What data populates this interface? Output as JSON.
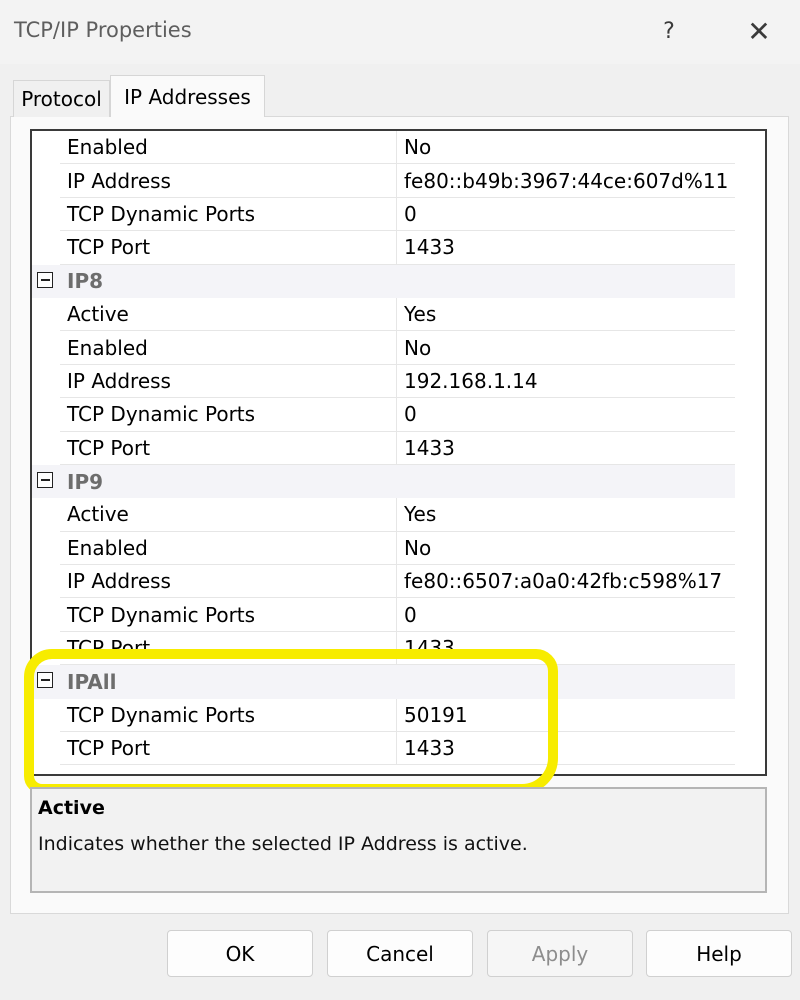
{
  "window": {
    "title": "TCP/IP Properties",
    "help_glyph": "?",
    "close_glyph": "✕"
  },
  "tabs": [
    {
      "label": "Protocol",
      "selected": false
    },
    {
      "label": "IP Addresses",
      "selected": true
    }
  ],
  "grid": {
    "rows": [
      {
        "type": "prop",
        "name": "Enabled",
        "value": "No"
      },
      {
        "type": "prop",
        "name": "IP Address",
        "value": "fe80::b49b:3967:44ce:607d%11"
      },
      {
        "type": "prop",
        "name": "TCP Dynamic Ports",
        "value": "0"
      },
      {
        "type": "prop",
        "name": "TCP Port",
        "value": "1433"
      },
      {
        "type": "category",
        "name": "IP8"
      },
      {
        "type": "prop",
        "name": "Active",
        "value": "Yes"
      },
      {
        "type": "prop",
        "name": "Enabled",
        "value": "No"
      },
      {
        "type": "prop",
        "name": "IP Address",
        "value": "192.168.1.14"
      },
      {
        "type": "prop",
        "name": "TCP Dynamic Ports",
        "value": "0"
      },
      {
        "type": "prop",
        "name": "TCP Port",
        "value": "1433"
      },
      {
        "type": "category",
        "name": "IP9"
      },
      {
        "type": "prop",
        "name": "Active",
        "value": "Yes"
      },
      {
        "type": "prop",
        "name": "Enabled",
        "value": "No"
      },
      {
        "type": "prop",
        "name": "IP Address",
        "value": "fe80::6507:a0a0:42fb:c598%17"
      },
      {
        "type": "prop",
        "name": "TCP Dynamic Ports",
        "value": "0"
      },
      {
        "type": "prop",
        "name": "TCP Port",
        "value": "1433"
      },
      {
        "type": "category",
        "name": "IPAll"
      },
      {
        "type": "prop",
        "name": "TCP Dynamic Ports",
        "value": "50191"
      },
      {
        "type": "prop",
        "name": "TCP Port",
        "value": "1433"
      }
    ]
  },
  "description": {
    "title": "Active",
    "text": "Indicates whether the selected IP Address is active."
  },
  "buttons": {
    "ok": "OK",
    "cancel": "Cancel",
    "apply": "Apply",
    "help": "Help"
  },
  "colors": {
    "highlight": "#f7ec00",
    "category_text": "#6d6d6d",
    "disabled_text": "#8d8d8d"
  }
}
